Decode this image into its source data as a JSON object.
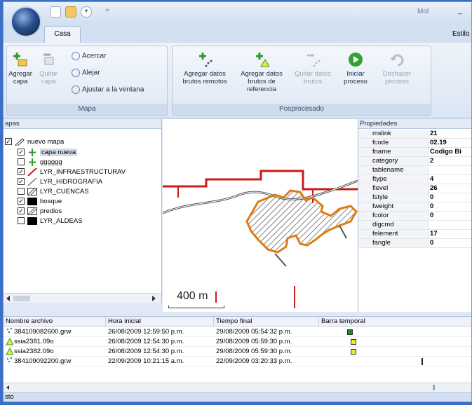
{
  "window": {
    "title": "Mol",
    "minimize": "_"
  },
  "quick_access": {
    "dropdown": "="
  },
  "tabs": {
    "casa": "Casa",
    "style": "Estilo"
  },
  "ribbon": {
    "mapa": {
      "label": "Mapa",
      "add_layer": "Agregar\ncapa",
      "remove_layer": "Quitar\ncapa",
      "zoom_in": "Acercar",
      "zoom_out": "Alejar",
      "fit_window": "Ajustar a la ventana"
    },
    "post": {
      "label": "Posprocesado",
      "add_remote": "Agregar datos\nbrutos remotos",
      "add_reference": "Agregar datos\nbrutos de\nreferencia",
      "remove_raw": "Quitar datos\nbrutos",
      "start": "Iniciar\nproceso",
      "undo": "Deshacer\nproceso"
    }
  },
  "layers": {
    "header": "apas",
    "root": "nuevo mapa",
    "items": [
      {
        "label": "capa nueva",
        "checked": true,
        "symbol": "cross-green",
        "selected": true
      },
      {
        "label": "gggggg",
        "checked": false,
        "symbol": "cross-green",
        "selected": false
      },
      {
        "label": "LYR_INFRAESTRUCTURAV",
        "checked": true,
        "symbol": "line-red",
        "selected": false
      },
      {
        "label": "LYR_HIDROGRAFIA",
        "checked": true,
        "symbol": "line-gray",
        "selected": false
      },
      {
        "label": "LYR_CUENCAS",
        "checked": false,
        "symbol": "hatch",
        "selected": false
      },
      {
        "label": "bosque",
        "checked": true,
        "symbol": "fill-black",
        "selected": false
      },
      {
        "label": "predios",
        "checked": true,
        "symbol": "hatch",
        "selected": false
      },
      {
        "label": "LYR_ALDEAS",
        "checked": false,
        "symbol": "fill-black",
        "selected": false
      }
    ]
  },
  "map": {
    "scale_label": "400 m"
  },
  "properties": {
    "header": "Propiedades",
    "rows": [
      {
        "key": "mslink",
        "value": "21"
      },
      {
        "key": "fcode",
        "value": "02.19"
      },
      {
        "key": "fname",
        "value": "Codigo Bi"
      },
      {
        "key": "category",
        "value": "2"
      },
      {
        "key": "tablename",
        "value": ""
      },
      {
        "key": "ftype",
        "value": "4"
      },
      {
        "key": "flevel",
        "value": "26"
      },
      {
        "key": "fstyle",
        "value": "0"
      },
      {
        "key": "fweight",
        "value": "0"
      },
      {
        "key": "fcolor",
        "value": "0"
      },
      {
        "key": "digcmd",
        "value": ""
      },
      {
        "key": "felement",
        "value": "17"
      },
      {
        "key": "fangle",
        "value": "0"
      }
    ]
  },
  "table": {
    "columns": [
      "Nombre archivo",
      "Hora inicial",
      "Tiempo final",
      "Barra temporal"
    ],
    "rows": [
      {
        "name": "384109082600.grw",
        "start": "26/08/2009 12:59:50 p.m.",
        "end": "29/08/2009 05:54:32 p.m.",
        "icon": "remote",
        "bar_color": "#1f8a1f"
      },
      {
        "name": "ssia2381.09o",
        "start": "26/08/2009 12:54:30 p.m.",
        "end": "29/08/2009 05:59:30 p.m.",
        "icon": "reference",
        "bar_color": "#f0e82a"
      },
      {
        "name": "ssia2382.09o",
        "start": "26/08/2009 12:54:30 p.m.",
        "end": "29/08/2009 05:59:30 p.m.",
        "icon": "reference",
        "bar_color": "#f0e82a"
      },
      {
        "name": "384109092200.grw",
        "start": "22/09/2009 10:21:15 a.m.",
        "end": "22/09/2009 03:20:33 p.m.",
        "icon": "remote",
        "bar_color": "#222222"
      }
    ]
  },
  "status": {
    "text": "sto"
  },
  "colors": {
    "accent": "#3b6fc8",
    "polygon_outline": "#e07b13",
    "road": "#cc1a1a",
    "river": "#555555"
  }
}
